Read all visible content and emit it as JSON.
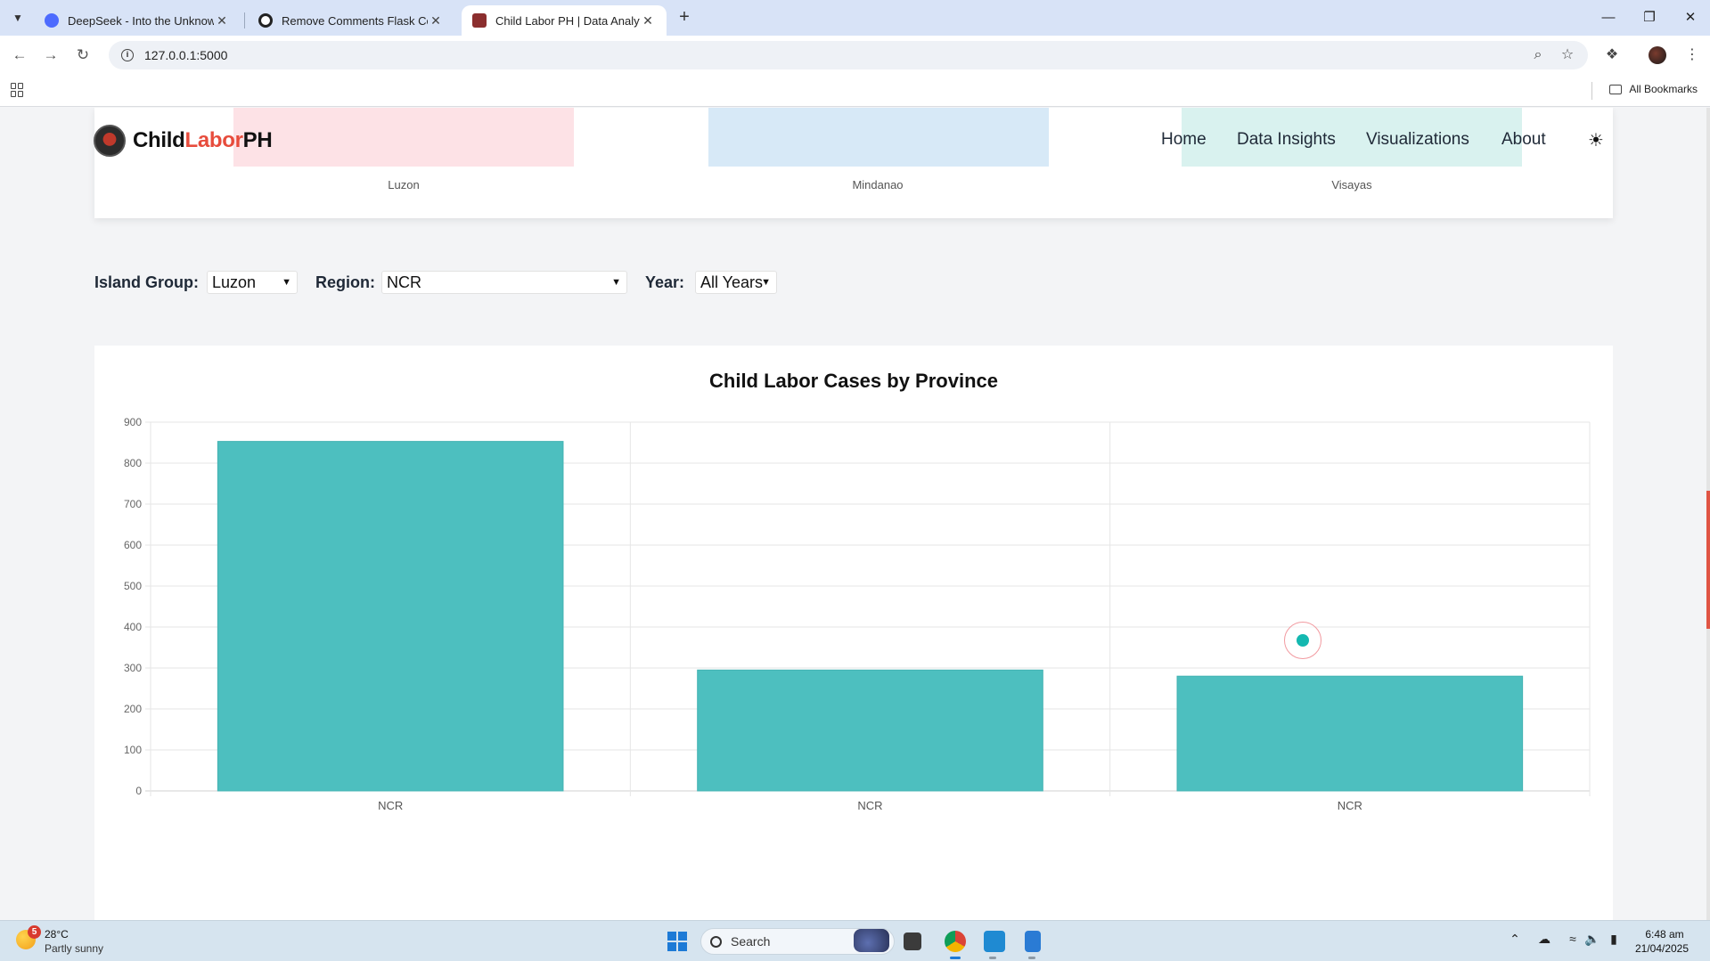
{
  "browser": {
    "tabs": [
      {
        "title": "DeepSeek - Into the Unknown",
        "active": false
      },
      {
        "title": "Remove Comments Flask Code",
        "active": false
      },
      {
        "title": "Child Labor PH | Data Analytics",
        "active": true
      }
    ],
    "url": "127.0.0.1:5000",
    "all_bookmarks_label": "All Bookmarks"
  },
  "site": {
    "brand_part1": "Child",
    "brand_part2": "Labor",
    "brand_part3": "PH",
    "nav": [
      "Home",
      "Data Insights",
      "Visualizations",
      "About"
    ]
  },
  "island_groups": {
    "labels": [
      "Luzon",
      "Mindanao",
      "Visayas"
    ],
    "colors": [
      "#fde2e6",
      "#d7e9f7",
      "#d9f2ef"
    ]
  },
  "filters": {
    "island_group_label": "Island Group:",
    "island_group_value": "Luzon",
    "region_label": "Region:",
    "region_value": "NCR",
    "year_label": "Year:",
    "year_value": "All Years"
  },
  "chart_data": {
    "type": "bar",
    "title": "Child Labor Cases by Province",
    "categories": [
      "NCR",
      "NCR",
      "NCR"
    ],
    "values": [
      853,
      295,
      280
    ],
    "ylim": [
      0,
      900
    ],
    "yticks": [
      0,
      100,
      200,
      300,
      400,
      500,
      600,
      700,
      800,
      900
    ],
    "xlabel": "",
    "ylabel": "",
    "grid": true,
    "bar_color": "#4dbfbf"
  },
  "taskbar": {
    "weather_temp": "28°C",
    "weather_desc": "Partly sunny",
    "weather_badge": "5",
    "search_placeholder": "Search",
    "time": "6:48 am",
    "date": "21/04/2025"
  }
}
